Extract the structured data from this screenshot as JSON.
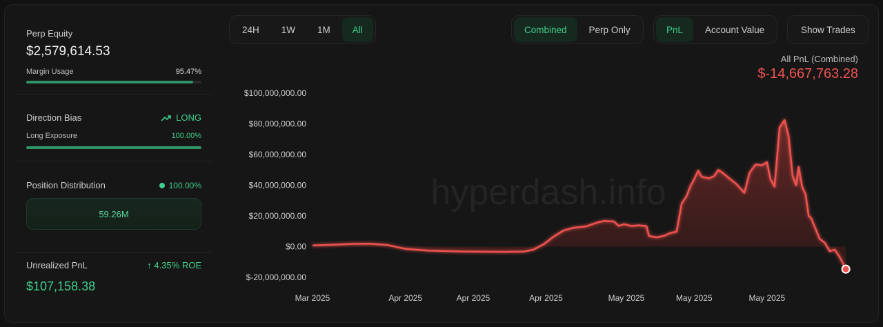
{
  "left_panel": {
    "perp_equity": {
      "label": "Perp Equity",
      "value": "$2,579,614.53"
    },
    "margin_usage": {
      "label": "Margin Usage",
      "value": "95.47%",
      "fill": 0.9547
    },
    "direction_bias": {
      "label": "Direction Bias",
      "value": "LONG",
      "icon": "trend-up-icon"
    },
    "long_exposure": {
      "label": "Long Exposure",
      "value": "100.00%",
      "fill": 1.0
    },
    "position_distribution": {
      "label": "Position Distribution",
      "value": "100.00%",
      "box_value": "59.26M"
    },
    "unrealized_pnl": {
      "label": "Unrealized PnL",
      "roe": "4.35% ROE",
      "value": "$107,158.38"
    }
  },
  "toolbar": {
    "timeframes": [
      "24H",
      "1W",
      "1M",
      "All"
    ],
    "active_timeframe": "All",
    "mode": [
      "Combined",
      "Perp Only"
    ],
    "active_mode": "Combined",
    "metric": [
      "PnL",
      "Account Value"
    ],
    "active_metric": "PnL",
    "show_trades": "Show Trades"
  },
  "summary": {
    "label": "All PnL (Combined)",
    "value": "$-14,667,763.28"
  },
  "colors": {
    "accent_green": "#3fcf8e",
    "loss_red": "#ef5350",
    "background": "#161616"
  },
  "chart_data": {
    "type": "area",
    "watermark": "hyperdash.info",
    "ylim": [
      -20000000,
      100000000
    ],
    "y_ticks": [
      -20000000,
      0,
      20000000,
      40000000,
      60000000,
      80000000,
      100000000
    ],
    "y_tick_labels": [
      "$-20,000,000.00",
      "$0.00",
      "$20,000,000.00",
      "$40,000,000.00",
      "$60,000,000.00",
      "$80,000,000.00",
      "$100,000,000.00"
    ],
    "x_tick_labels": [
      "Mar 2025",
      "Apr 2025",
      "Apr 2025",
      "Apr 2025",
      "May 2025",
      "May 2025",
      "May 2025"
    ],
    "x_tick_positions": [
      0.0,
      0.185,
      0.32,
      0.465,
      0.625,
      0.76,
      0.905
    ],
    "series": [
      {
        "points": [
          [
            0.0,
            800000
          ],
          [
            0.04,
            1200000
          ],
          [
            0.08,
            1800000
          ],
          [
            0.115,
            1900000
          ],
          [
            0.15,
            1000000
          ],
          [
            0.185,
            -1500000
          ],
          [
            0.23,
            -2600000
          ],
          [
            0.3,
            -3200000
          ],
          [
            0.38,
            -3400000
          ],
          [
            0.42,
            -3300000
          ],
          [
            0.44,
            -2000000
          ],
          [
            0.46,
            1500000
          ],
          [
            0.48,
            6500000
          ],
          [
            0.5,
            10500000
          ],
          [
            0.52,
            12300000
          ],
          [
            0.545,
            13200000
          ],
          [
            0.565,
            15500000
          ],
          [
            0.58,
            16700000
          ],
          [
            0.6,
            16400000
          ],
          [
            0.61,
            13500000
          ],
          [
            0.62,
            14600000
          ],
          [
            0.635,
            13500000
          ],
          [
            0.65,
            13900000
          ],
          [
            0.665,
            13400000
          ],
          [
            0.67,
            6900000
          ],
          [
            0.685,
            6000000
          ],
          [
            0.7,
            7000000
          ],
          [
            0.712,
            8800000
          ],
          [
            0.725,
            9700000
          ],
          [
            0.735,
            28000000
          ],
          [
            0.745,
            33000000
          ],
          [
            0.752,
            39000000
          ],
          [
            0.76,
            44000000
          ],
          [
            0.768,
            49500000
          ],
          [
            0.775,
            45500000
          ],
          [
            0.79,
            44500000
          ],
          [
            0.8,
            46000000
          ],
          [
            0.808,
            50000000
          ],
          [
            0.815,
            48500000
          ],
          [
            0.83,
            44500000
          ],
          [
            0.845,
            40500000
          ],
          [
            0.86,
            35000000
          ],
          [
            0.87,
            48000000
          ],
          [
            0.882,
            53500000
          ],
          [
            0.895,
            53000000
          ],
          [
            0.905,
            55000000
          ],
          [
            0.912,
            44000000
          ],
          [
            0.92,
            39000000
          ],
          [
            0.93,
            77500000
          ],
          [
            0.94,
            82500000
          ],
          [
            0.948,
            72000000
          ],
          [
            0.956,
            46000000
          ],
          [
            0.963,
            40000000
          ],
          [
            0.968,
            52000000
          ],
          [
            0.975,
            39000000
          ],
          [
            0.982,
            34000000
          ],
          [
            0.988,
            20000000
          ],
          [
            0.993,
            18500000
          ],
          [
            1.0,
            13000000
          ],
          [
            1.01,
            5000000
          ],
          [
            1.02,
            2500000
          ],
          [
            1.03,
            -3000000
          ],
          [
            1.04,
            -2000000
          ],
          [
            1.05,
            -7000000
          ],
          [
            1.062,
            -14667763
          ]
        ]
      }
    ]
  }
}
